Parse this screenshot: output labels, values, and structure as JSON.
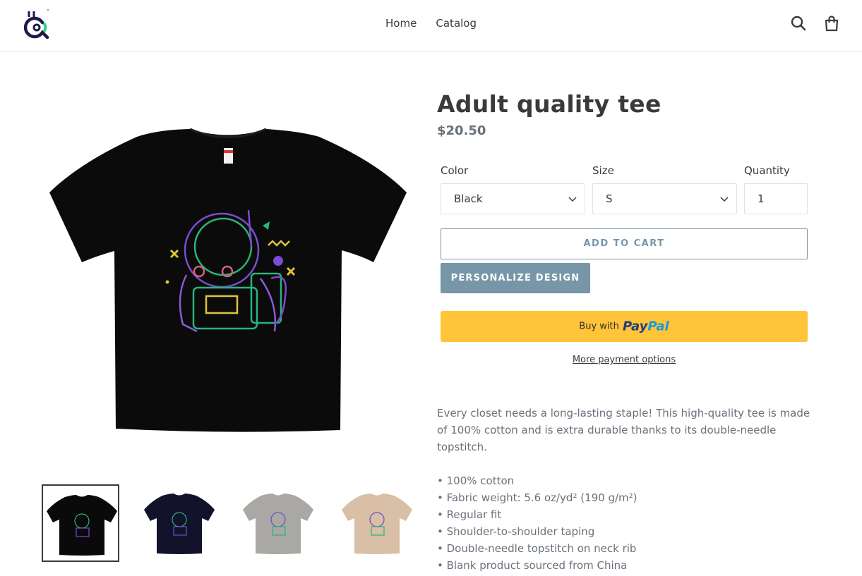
{
  "header": {
    "nav": [
      "Home",
      "Catalog"
    ],
    "icons": [
      "search-icon",
      "cart-icon"
    ]
  },
  "product": {
    "title": "Adult quality tee",
    "price": "$20.50",
    "options": {
      "color_label": "Color",
      "color_value": "Black",
      "size_label": "Size",
      "size_value": "S",
      "quantity_label": "Quantity",
      "quantity_value": "1"
    },
    "add_to_cart": "ADD TO CART",
    "personalize": "PERSONALIZE DESIGN",
    "paypal": {
      "buy_with": "Buy with",
      "pay": "Pay",
      "pal": "Pal"
    },
    "more_payment": "More payment options",
    "description": "Every closet needs a long-lasting staple! This high-quality tee is made of 100% cotton and is extra durable thanks to its double-needle topstitch.",
    "features": [
      "• 100% cotton",
      "• Fabric weight: 5.6 oz/yd² (190 g/m²)",
      "• Regular fit",
      "• Shoulder-to-shoulder taping",
      "• Double-needle topstitch on neck rib",
      "• Blank product sourced from China"
    ],
    "thumbnail_colors": [
      "#0a0a0a",
      "#12132b",
      "#a9a8a4",
      "#d8bfa6"
    ]
  },
  "colors": {
    "accent": "#7796a8",
    "paypal_yellow": "#ffc439",
    "text": "#3a3a3a",
    "muted": "#69727b"
  }
}
